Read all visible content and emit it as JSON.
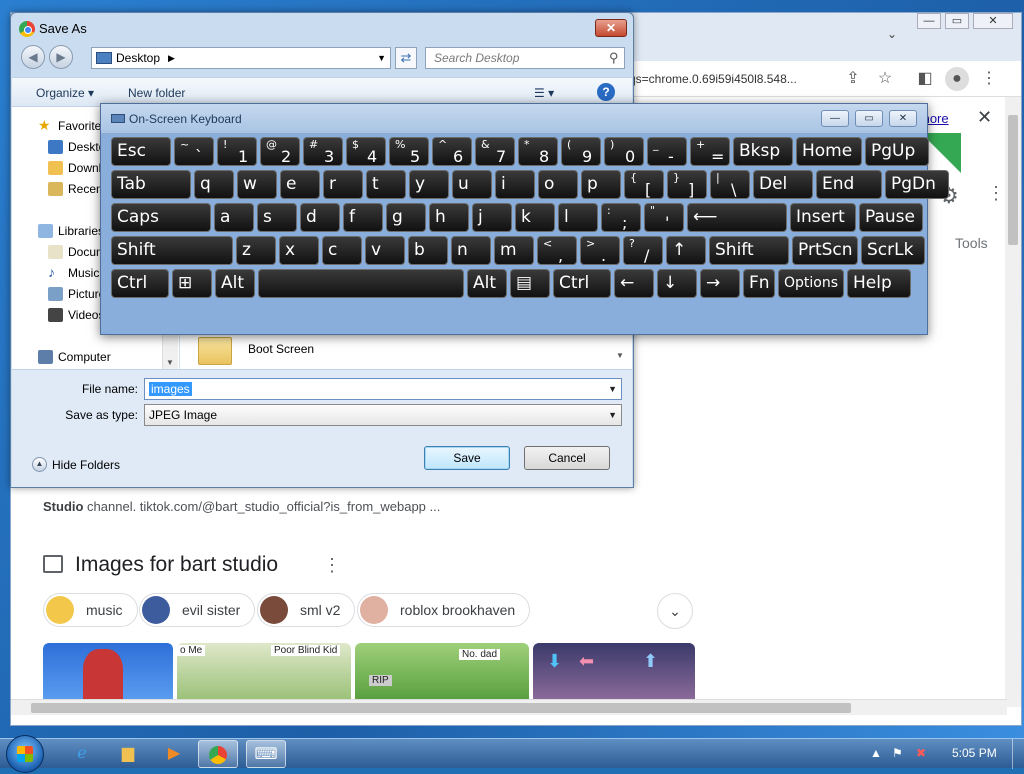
{
  "chrome": {
    "url_fragment": "qs=chrome.0.69i59i450l8.548...",
    "more_link": "more",
    "tools_label": "Tools",
    "snippet_bold": "Studio",
    "snippet_rest": " channel. tiktok.com/@bart_studio_official?is_from_webapp ...",
    "images_heading": "Images for bart studio",
    "chips": [
      "music",
      "evil sister",
      "sml v2",
      "roblox brookhaven"
    ],
    "thumb_labels": [
      "o Me",
      "Poor Blind Kid",
      "No. dad",
      "RIP"
    ]
  },
  "save_dialog": {
    "title": "Save As",
    "location": "Desktop",
    "search_placeholder": "Search Desktop",
    "organize": "Organize",
    "new_folder": "New folder",
    "nav_items": [
      "Favorites",
      "Desktop",
      "Downloads",
      "Recent Places",
      "Libraries",
      "Documents",
      "Music",
      "Pictures",
      "Videos",
      "Computer"
    ],
    "file_item": "Boot Screen",
    "file_name_label": "File name:",
    "file_name_value": "images",
    "save_type_label": "Save as type:",
    "save_type_value": "JPEG Image",
    "hide_folders": "Hide Folders",
    "save_button": "Save",
    "cancel_button": "Cancel"
  },
  "osk": {
    "title": "On-Screen Keyboard",
    "rows": [
      [
        {
          "main": "Esc"
        },
        {
          "top": "~",
          "bot": "`"
        },
        {
          "top": "!",
          "bot": "1"
        },
        {
          "top": "@",
          "bot": "2"
        },
        {
          "top": "#",
          "bot": "3"
        },
        {
          "top": "$",
          "bot": "4"
        },
        {
          "top": "%",
          "bot": "5"
        },
        {
          "top": "^",
          "bot": "6"
        },
        {
          "top": "&",
          "bot": "7"
        },
        {
          "top": "*",
          "bot": "8"
        },
        {
          "top": "(",
          "bot": "9"
        },
        {
          "top": ")",
          "bot": "0"
        },
        {
          "top": "_",
          "bot": "-"
        },
        {
          "top": "+",
          "bot": "="
        },
        {
          "main": "Bksp"
        },
        {
          "main": "Home"
        },
        {
          "main": "PgUp"
        }
      ],
      [
        {
          "main": "Tab"
        },
        {
          "main": "q"
        },
        {
          "main": "w"
        },
        {
          "main": "e"
        },
        {
          "main": "r"
        },
        {
          "main": "t"
        },
        {
          "main": "y"
        },
        {
          "main": "u"
        },
        {
          "main": "i"
        },
        {
          "main": "o"
        },
        {
          "main": "p"
        },
        {
          "top": "{",
          "bot": "["
        },
        {
          "top": "}",
          "bot": "]"
        },
        {
          "top": "|",
          "bot": "\\"
        },
        {
          "main": "Del"
        },
        {
          "main": "End"
        },
        {
          "main": "PgDn"
        }
      ],
      [
        {
          "main": "Caps"
        },
        {
          "main": "a"
        },
        {
          "main": "s"
        },
        {
          "main": "d"
        },
        {
          "main": "f"
        },
        {
          "main": "g"
        },
        {
          "main": "h"
        },
        {
          "main": "j"
        },
        {
          "main": "k"
        },
        {
          "main": "l"
        },
        {
          "top": ":",
          "bot": ";"
        },
        {
          "top": "\"",
          "bot": "'"
        },
        {
          "main": "⟵"
        },
        {
          "main": "Insert"
        },
        {
          "main": "Pause"
        }
      ],
      [
        {
          "main": "Shift"
        },
        {
          "main": "z"
        },
        {
          "main": "x"
        },
        {
          "main": "c"
        },
        {
          "main": "v"
        },
        {
          "main": "b"
        },
        {
          "main": "n"
        },
        {
          "main": "m"
        },
        {
          "top": "<",
          "bot": ","
        },
        {
          "top": ">",
          "bot": "."
        },
        {
          "top": "?",
          "bot": "/"
        },
        {
          "main": "↑"
        },
        {
          "main": "Shift"
        },
        {
          "main": "PrtScn"
        },
        {
          "main": "ScrLk"
        }
      ],
      [
        {
          "main": "Ctrl"
        },
        {
          "main": "⊞"
        },
        {
          "main": "Alt"
        },
        {
          "main": ""
        },
        {
          "main": "Alt"
        },
        {
          "main": "▤"
        },
        {
          "main": "Ctrl"
        },
        {
          "main": "←"
        },
        {
          "main": "↓"
        },
        {
          "main": "→"
        },
        {
          "main": "Fn"
        },
        {
          "main": "Options"
        },
        {
          "main": "Help"
        }
      ]
    ]
  },
  "taskbar": {
    "clock": "5:05 PM"
  }
}
